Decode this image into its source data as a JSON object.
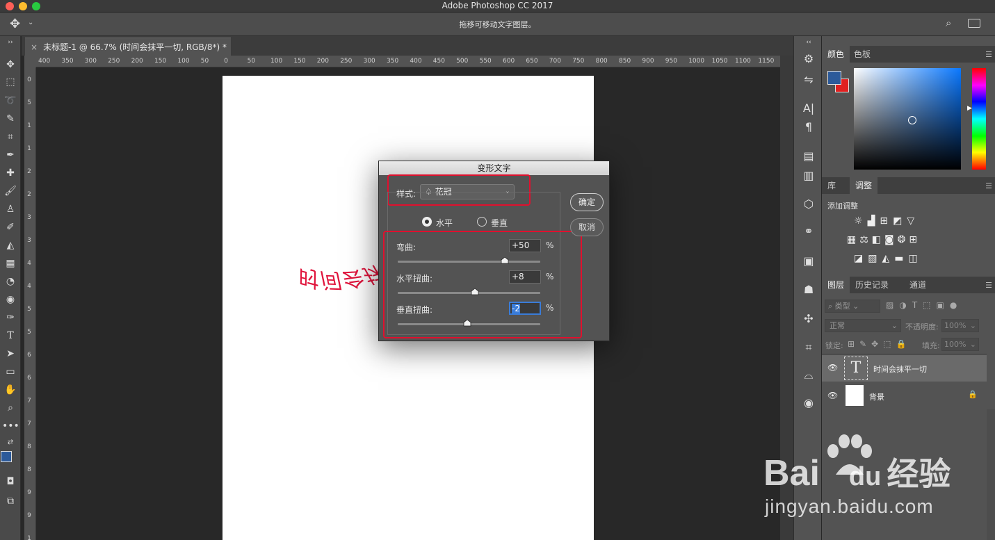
{
  "app": {
    "window_title": "Adobe Photoshop CC 2017",
    "hint_text": "拖移可移动文字图层。"
  },
  "document": {
    "tab_title": "未标题-1 @ 66.7% (时间会抹平一切, RGB/8*) *",
    "close_glyph": "×",
    "canvas_text": "时间会抹平一切",
    "ruler_h": [
      "400",
      "350",
      "300",
      "250",
      "200",
      "150",
      "100",
      "50",
      "0",
      "50",
      "100",
      "150",
      "200",
      "250",
      "300",
      "350",
      "400",
      "450",
      "500",
      "550",
      "600",
      "650",
      "700",
      "750",
      "800",
      "850",
      "900",
      "950",
      "1000",
      "1050",
      "1100",
      "1150"
    ],
    "ruler_v": [
      "0",
      "5",
      "1",
      "1",
      "2",
      "2",
      "3",
      "3",
      "4",
      "4",
      "5",
      "5",
      "6",
      "6",
      "7",
      "7",
      "8",
      "8",
      "9",
      "9",
      "1"
    ]
  },
  "dialog": {
    "title": "变形文字",
    "style_label": "样式:",
    "style_value": "花冠",
    "orientation": [
      {
        "label": "水平",
        "selected": true
      },
      {
        "label": "垂直",
        "selected": false
      }
    ],
    "bend": {
      "label": "弯曲:",
      "value": "+50",
      "unit": "%",
      "percent": 50
    },
    "h_distortion": {
      "label": "水平扭曲:",
      "value": "+8",
      "unit": "%",
      "percent": 8
    },
    "v_distortion": {
      "label": "垂直扭曲:",
      "value": "-2",
      "unit": "%",
      "percent": -2
    },
    "ok_label": "确定",
    "cancel_label": "取消"
  },
  "color_panel": {
    "tabs": [
      "颜色",
      "色板"
    ],
    "foreground": "#2c5a9a",
    "background": "#e02020"
  },
  "adjust_panel": {
    "tabs": [
      "库",
      "调整"
    ],
    "heading": "添加调整"
  },
  "layers_panel": {
    "tabs": [
      "图层",
      "历史记录",
      "通道"
    ],
    "filter_label": "类型",
    "blend_mode": "正常",
    "opacity_label": "不透明度:",
    "opacity_value": "100%",
    "lock_label": "锁定:",
    "fill_label": "填充:",
    "fill_value": "100%",
    "layers": [
      {
        "name": "时间会抹平一切",
        "type": "text",
        "selected": true
      },
      {
        "name": "背景",
        "type": "background",
        "selected": false
      }
    ]
  },
  "watermark": {
    "brand": "Bai",
    "brand_mid": "du",
    "brand_cn": "经验",
    "url": "jingyan.baidu.com"
  }
}
